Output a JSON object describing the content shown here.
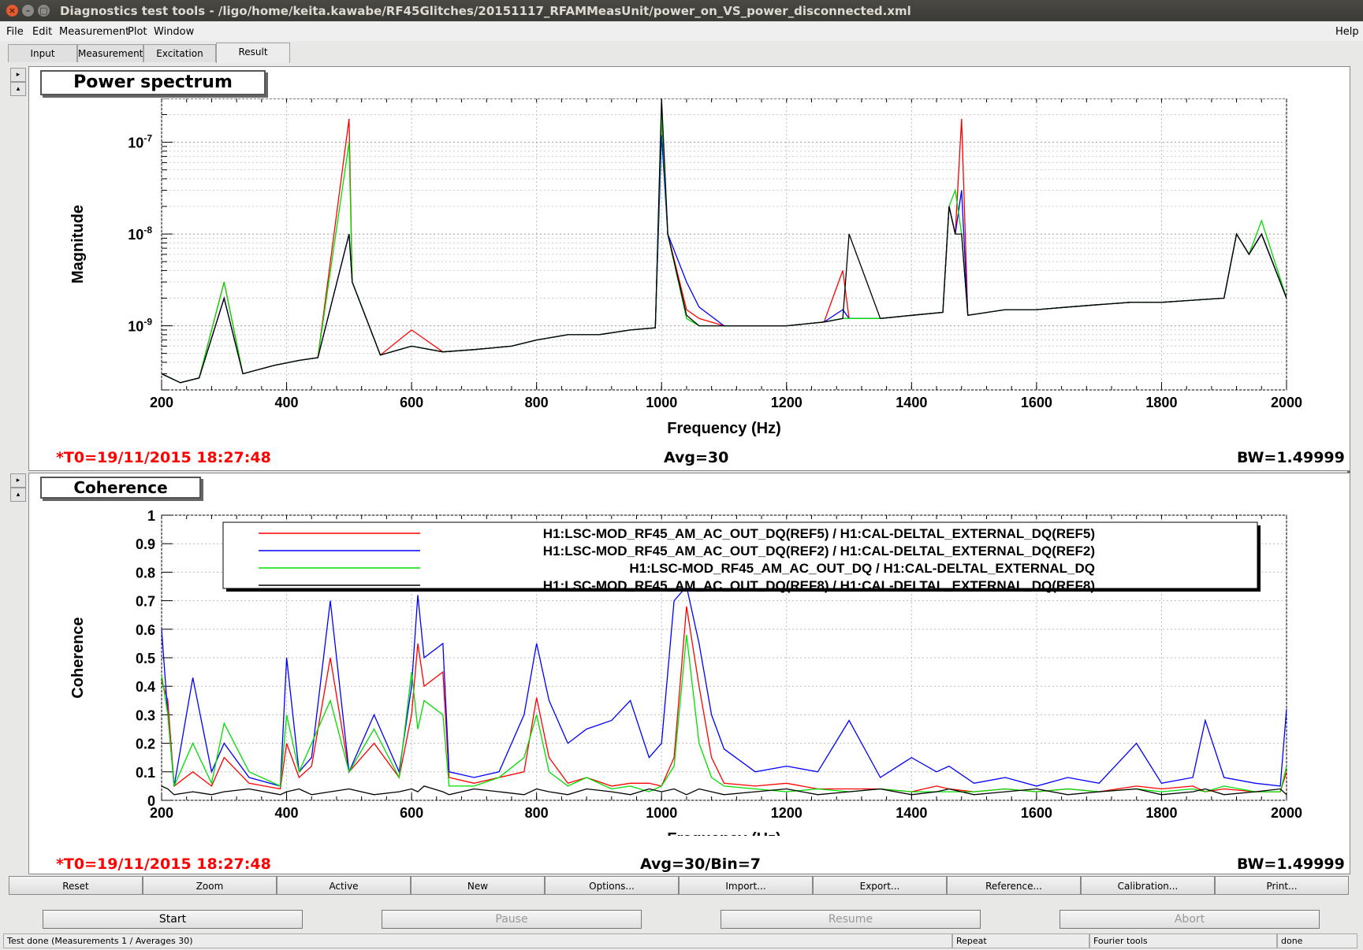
{
  "window": {
    "title": "Diagnostics test tools - /ligo/home/keita.kawabe/RF45Glitches/20151117_RFAMMeasUnit/power_on_VS_power_disconnected.xml",
    "close_glyph": "×",
    "min_glyph": "–",
    "max_glyph": "□"
  },
  "menu": {
    "file": "File",
    "edit": "Edit",
    "measurement": "Measurement",
    "plot": "Plot",
    "window": "Window",
    "help": "Help"
  },
  "tabs": {
    "input": "Input",
    "measurement": "Measurement",
    "excitation": "Excitation",
    "result": "Result",
    "active": "Result"
  },
  "top_panel": {
    "title": "Power spectrum",
    "t0": "*T0=19/11/2015 18:27:48",
    "avg": "Avg=30",
    "bw": "BW=1.49999"
  },
  "bottom_panel": {
    "title": "Coherence",
    "t0": "*T0=19/11/2015 18:27:48",
    "avg": "Avg=30/Bin=7",
    "bw": "BW=1.49999"
  },
  "buttons_row1": [
    "Reset",
    "Zoom",
    "Active",
    "New",
    "Options...",
    "Import...",
    "Export...",
    "Reference...",
    "Calibration...",
    "Print..."
  ],
  "buttons_row2": {
    "start": "Start",
    "pause": "Pause",
    "resume": "Resume",
    "abort": "Abort"
  },
  "status": {
    "main": "Test done (Measurements 1 / Averages 30)",
    "repeat": "Repeat",
    "tools": "Fourier tools",
    "state": "done"
  },
  "colors": {
    "red": "#ff0000",
    "blue": "#0000ff",
    "green": "#00dd00",
    "black": "#000000"
  },
  "chart_data": [
    {
      "type": "line",
      "title": "",
      "xlabel": "Frequency (Hz)",
      "ylabel": "Magnitude",
      "xlim": [
        200,
        2000
      ],
      "ylim": [
        2e-10,
        3e-07
      ],
      "yscale": "log",
      "x_ticks": [
        "200",
        "400",
        "600",
        "800",
        "1000",
        "1200",
        "1400",
        "1600",
        "1800",
        "2000"
      ],
      "y_ticks": [
        {
          "base": "10",
          "exp": "-7",
          "value": 1e-07
        },
        {
          "base": "10",
          "exp": "-8",
          "value": 1e-08
        },
        {
          "base": "10",
          "exp": "-9",
          "value": 1e-09
        }
      ],
      "grid": true,
      "x": [
        200,
        230,
        260,
        300,
        330,
        380,
        420,
        450,
        500,
        505,
        550,
        600,
        650,
        700,
        760,
        800,
        850,
        900,
        950,
        990,
        1000,
        1010,
        1040,
        1060,
        1100,
        1150,
        1200,
        1260,
        1290,
        1300,
        1350,
        1400,
        1450,
        1460,
        1470,
        1480,
        1490,
        1550,
        1600,
        1650,
        1700,
        1750,
        1800,
        1850,
        1900,
        1920,
        1940,
        1960,
        2000
      ],
      "series": [
        {
          "values": [
            3e-10,
            2.4e-10,
            2.7e-10,
            3e-09,
            3e-10,
            3.7e-10,
            4.2e-10,
            4.5e-10,
            1.8e-07,
            3e-09,
            4.8e-10,
            9e-10,
            5.2e-10,
            5.5e-10,
            6e-10,
            7e-10,
            8e-10,
            8e-10,
            9e-10,
            9.5e-10,
            2e-07,
            1e-08,
            1.5e-09,
            1.2e-09,
            1e-09,
            1e-09,
            1e-09,
            1.1e-09,
            4e-09,
            1.2e-09,
            1.2e-09,
            1.3e-09,
            1.4e-09,
            2e-08,
            1e-08,
            1.8e-07,
            1.3e-09,
            1.5e-09,
            1.5e-09,
            1.6e-09,
            1.7e-09,
            1.8e-09,
            1.8e-09,
            1.9e-09,
            2e-09,
            1e-08,
            6e-09,
            1e-08,
            2e-09
          ]
        },
        {
          "values": [
            3e-10,
            2.4e-10,
            2.7e-10,
            2e-09,
            3e-10,
            3.7e-10,
            4.2e-10,
            4.5e-10,
            1e-08,
            3e-09,
            4.8e-10,
            6e-10,
            5.2e-10,
            5.5e-10,
            6e-10,
            7e-10,
            8e-10,
            8e-10,
            9e-10,
            9.5e-10,
            1.2e-07,
            1e-08,
            3e-09,
            1.6e-09,
            1e-09,
            1e-09,
            1e-09,
            1.1e-09,
            1.5e-09,
            1.2e-09,
            1.2e-09,
            1.3e-09,
            1.4e-09,
            2e-08,
            1e-08,
            3e-08,
            1.3e-09,
            1.5e-09,
            1.5e-09,
            1.6e-09,
            1.7e-09,
            1.8e-09,
            1.8e-09,
            1.9e-09,
            2e-09,
            1e-08,
            6e-09,
            1e-08,
            2e-09
          ]
        },
        {
          "values": [
            3e-10,
            2.4e-10,
            2.7e-10,
            3e-09,
            3e-10,
            3.7e-10,
            4.2e-10,
            4.5e-10,
            1e-07,
            3e-09,
            4.8e-10,
            6e-10,
            5.2e-10,
            5.5e-10,
            6e-10,
            7e-10,
            8e-10,
            8e-10,
            9e-10,
            9.5e-10,
            2e-07,
            1e-08,
            1.2e-09,
            1e-09,
            1e-09,
            1e-09,
            1e-09,
            1.1e-09,
            1.2e-09,
            1.2e-09,
            1.2e-09,
            1.3e-09,
            1.4e-09,
            2e-08,
            3e-08,
            1e-08,
            1.3e-09,
            1.5e-09,
            1.5e-09,
            1.6e-09,
            1.7e-09,
            1.8e-09,
            1.8e-09,
            1.9e-09,
            2e-09,
            1e-08,
            6e-09,
            1.4e-08,
            2e-09
          ]
        },
        {
          "values": [
            3e-10,
            2.4e-10,
            2.7e-10,
            2e-09,
            3e-10,
            3.7e-10,
            4.2e-10,
            4.5e-10,
            1e-08,
            3e-09,
            4.8e-10,
            6e-10,
            5.2e-10,
            5.5e-10,
            6e-10,
            7e-10,
            8e-10,
            8e-10,
            9e-10,
            9.5e-10,
            3e-07,
            1e-08,
            1.3e-09,
            1e-09,
            1e-09,
            1e-09,
            1e-09,
            1.1e-09,
            1.2e-09,
            1e-08,
            1.2e-09,
            1.3e-09,
            1.4e-09,
            2e-08,
            1e-08,
            1e-08,
            1.3e-09,
            1.5e-09,
            1.5e-09,
            1.6e-09,
            1.7e-09,
            1.8e-09,
            1.8e-09,
            1.9e-09,
            2e-09,
            1e-08,
            6e-09,
            1e-08,
            2e-09
          ]
        }
      ]
    },
    {
      "type": "line",
      "title": "",
      "xlabel": "Frequency (Hz)",
      "ylabel": "Coherence",
      "xlim": [
        200,
        2000
      ],
      "ylim": [
        0,
        1
      ],
      "x_ticks": [
        "200",
        "400",
        "600",
        "800",
        "1000",
        "1200",
        "1400",
        "1600",
        "1800",
        "2000"
      ],
      "y_ticks": [
        "0",
        "0.1",
        "0.2",
        "0.3",
        "0.4",
        "0.5",
        "0.6",
        "0.7",
        "0.8",
        "0.9",
        "1"
      ],
      "grid": true,
      "legend_position": "top",
      "x": [
        200,
        210,
        220,
        250,
        280,
        300,
        340,
        390,
        400,
        420,
        440,
        470,
        500,
        540,
        580,
        600,
        610,
        620,
        650,
        660,
        700,
        740,
        780,
        800,
        820,
        850,
        880,
        920,
        950,
        980,
        1000,
        1020,
        1040,
        1060,
        1080,
        1100,
        1150,
        1200,
        1250,
        1300,
        1350,
        1400,
        1440,
        1460,
        1500,
        1550,
        1600,
        1650,
        1700,
        1760,
        1800,
        1850,
        1870,
        1900,
        1950,
        1990,
        2000
      ],
      "series": [
        {
          "name": "H1:LSC-MOD_RF45_AM_AC_OUT_DQ(REF5) / H1:CAL-DELTAL_EXTERNAL_DQ(REF5)",
          "values": [
            0.42,
            0.35,
            0.05,
            0.1,
            0.05,
            0.15,
            0.06,
            0.04,
            0.2,
            0.08,
            0.12,
            0.5,
            0.1,
            0.2,
            0.08,
            0.3,
            0.55,
            0.4,
            0.45,
            0.08,
            0.06,
            0.08,
            0.1,
            0.36,
            0.15,
            0.06,
            0.08,
            0.05,
            0.06,
            0.06,
            0.05,
            0.15,
            0.68,
            0.4,
            0.15,
            0.06,
            0.05,
            0.06,
            0.04,
            0.04,
            0.04,
            0.03,
            0.05,
            0.04,
            0.03,
            0.04,
            0.03,
            0.04,
            0.03,
            0.05,
            0.04,
            0.05,
            0.03,
            0.04,
            0.03,
            0.03,
            0.1
          ]
        },
        {
          "name": "H1:LSC-MOD_RF45_AM_AC_OUT_DQ(REF2) / H1:CAL-DELTAL_EXTERNAL_DQ(REF2)",
          "values": [
            0.6,
            0.3,
            0.05,
            0.43,
            0.1,
            0.2,
            0.08,
            0.05,
            0.5,
            0.1,
            0.15,
            0.7,
            0.1,
            0.3,
            0.1,
            0.4,
            0.72,
            0.5,
            0.55,
            0.1,
            0.08,
            0.1,
            0.3,
            0.55,
            0.35,
            0.2,
            0.25,
            0.28,
            0.35,
            0.15,
            0.2,
            0.7,
            0.75,
            0.55,
            0.3,
            0.18,
            0.1,
            0.12,
            0.1,
            0.28,
            0.08,
            0.15,
            0.1,
            0.12,
            0.06,
            0.08,
            0.05,
            0.08,
            0.06,
            0.2,
            0.06,
            0.08,
            0.28,
            0.08,
            0.06,
            0.05,
            0.32
          ]
        },
        {
          "name": "H1:LSC-MOD_RF45_AM_AC_OUT_DQ / H1:CAL-DELTAL_EXTERNAL_DQ",
          "values": [
            0.44,
            0.3,
            0.05,
            0.2,
            0.06,
            0.27,
            0.1,
            0.05,
            0.3,
            0.1,
            0.2,
            0.35,
            0.1,
            0.25,
            0.08,
            0.45,
            0.25,
            0.35,
            0.3,
            0.05,
            0.05,
            0.08,
            0.15,
            0.3,
            0.1,
            0.05,
            0.08,
            0.04,
            0.05,
            0.03,
            0.05,
            0.12,
            0.58,
            0.2,
            0.08,
            0.05,
            0.04,
            0.03,
            0.04,
            0.03,
            0.04,
            0.03,
            0.03,
            0.03,
            0.03,
            0.04,
            0.03,
            0.04,
            0.03,
            0.04,
            0.03,
            0.04,
            0.03,
            0.05,
            0.03,
            0.03,
            0.12
          ]
        },
        {
          "name": "H1:LSC-MOD_RF45_AM_AC_OUT_DQ(REF8) / H1:CAL-DELTAL_EXTERNAL_DQ(REF8)",
          "values": [
            0.05,
            0.04,
            0.02,
            0.03,
            0.02,
            0.03,
            0.04,
            0.02,
            0.03,
            0.04,
            0.02,
            0.03,
            0.04,
            0.02,
            0.03,
            0.04,
            0.03,
            0.05,
            0.03,
            0.02,
            0.04,
            0.03,
            0.02,
            0.04,
            0.03,
            0.02,
            0.04,
            0.03,
            0.02,
            0.04,
            0.03,
            0.04,
            0.02,
            0.04,
            0.03,
            0.02,
            0.03,
            0.04,
            0.02,
            0.03,
            0.04,
            0.02,
            0.03,
            0.04,
            0.02,
            0.03,
            0.04,
            0.02,
            0.03,
            0.04,
            0.02,
            0.03,
            0.04,
            0.02,
            0.03,
            0.04,
            0.02
          ]
        }
      ]
    }
  ]
}
